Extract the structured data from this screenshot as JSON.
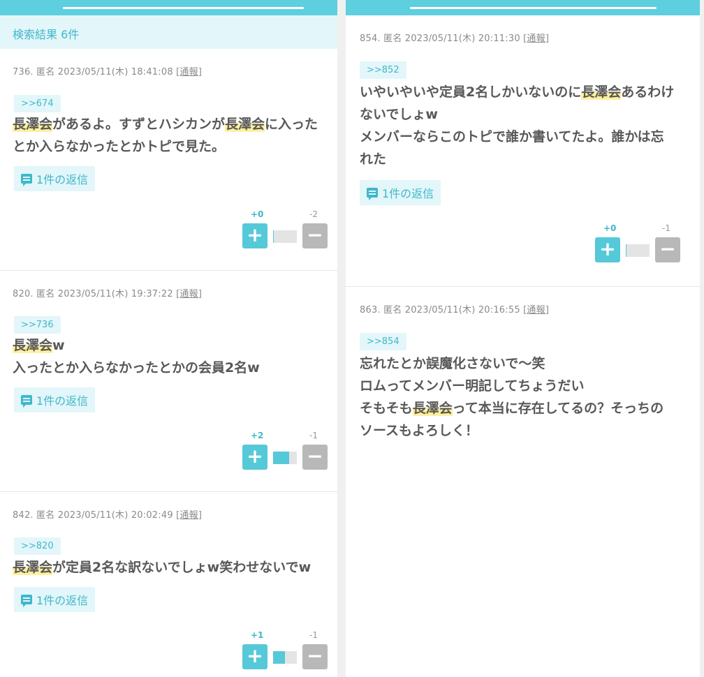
{
  "left_panel": {
    "search_header": "検索結果 6件",
    "comments": [
      {
        "meta": "736. 匿名 2023/05/11(木) 18:41:08",
        "report": "[通報]",
        "anchor": ">>674",
        "lines": [
          [
            {
              "hl": "長澤会"
            },
            {
              "t": "があるよ。すずとハシカンが"
            },
            {
              "hl": "長澤会"
            },
            {
              "t": "に入った"
            }
          ],
          [
            {
              "t": "とか入らなかったとかトピで見た。"
            }
          ]
        ],
        "reply_label": "1件の返信",
        "plus_count": "+0",
        "minus_count": "-2",
        "plus_ratio": 0.0
      },
      {
        "meta": "820. 匿名 2023/05/11(木) 19:37:22",
        "report": "[通報]",
        "anchor": ">>736",
        "lines": [
          [
            {
              "hl": "長澤会"
            },
            {
              "t": "w"
            }
          ],
          [
            {
              "t": "入ったとか入らなかったとかの会員2名w"
            }
          ]
        ],
        "reply_label": "1件の返信",
        "plus_count": "+2",
        "minus_count": "-1",
        "plus_ratio": 0.67
      },
      {
        "meta": "842. 匿名 2023/05/11(木) 20:02:49",
        "report": "[通報]",
        "anchor": ">>820",
        "lines": [
          [
            {
              "hl": "長澤会"
            },
            {
              "t": "が定員2名な訳ないでしょw笑わせないでw"
            }
          ]
        ],
        "reply_label": "1件の返信",
        "plus_count": "+1",
        "minus_count": "-1",
        "plus_ratio": 0.5
      }
    ]
  },
  "right_panel": {
    "comments": [
      {
        "meta": "854. 匿名 2023/05/11(木) 20:11:30",
        "report": "[通報]",
        "anchor": ">>852",
        "lines": [
          [
            {
              "t": "いやいやいや定員2名しかいないのに"
            },
            {
              "hl": "長澤会"
            },
            {
              "t": "あるわけ"
            }
          ],
          [
            {
              "t": "ないでしょw"
            }
          ],
          [
            {
              "t": "メンバーならこのトピで誰か書いてたよ。誰かは忘"
            }
          ],
          [
            {
              "t": "れた"
            }
          ]
        ],
        "reply_label": "1件の返信",
        "plus_count": "+0",
        "minus_count": "-1",
        "plus_ratio": 0.0
      },
      {
        "meta": "863. 匿名 2023/05/11(木) 20:16:55",
        "report": "[通報]",
        "anchor": ">>854",
        "lines": [
          [
            {
              "t": "忘れたとか誤魔化さないで〜笑"
            }
          ],
          [
            {
              "t": "ロムってメンバー明記してちょうだい"
            }
          ],
          [
            {
              "t": "そもそも"
            },
            {
              "hl": "長澤会"
            },
            {
              "t": "って本当に存在してるの？そっちの"
            }
          ],
          [
            {
              "t": "ソースもよろしく！"
            }
          ]
        ]
      }
    ]
  },
  "colors": {
    "accent": "#5dcfde",
    "accent_text": "#3fb8ca",
    "accent_light": "#e3f6fa",
    "highlight": "#fdf0a0",
    "minus_button": "#b8b8b8"
  },
  "icons": {
    "reply": "speech-bubble-icon",
    "plus": "plus-icon",
    "minus": "minus-icon"
  }
}
